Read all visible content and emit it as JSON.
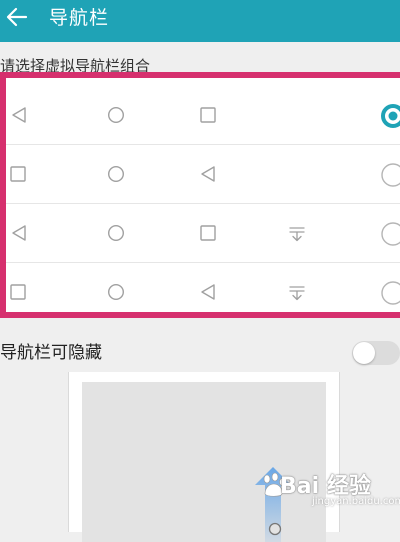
{
  "colors": {
    "header": "#1fa3b6",
    "accent": "#1fa3b6",
    "highlight_border": "#d6306e",
    "icon_stroke": "#a0a0a0"
  },
  "header": {
    "title": "导航栏",
    "back_icon": "arrow-left-icon"
  },
  "subtitle": "请选择虚拟导航栏组合",
  "options": [
    {
      "icons": [
        "back-icon",
        "home-icon",
        "recents-icon"
      ],
      "selected": true
    },
    {
      "icons": [
        "recents-icon",
        "home-icon",
        "back-icon"
      ],
      "selected": false
    },
    {
      "icons": [
        "back-icon",
        "home-icon",
        "recents-icon",
        "notification-pulldown-icon"
      ],
      "selected": false
    },
    {
      "icons": [
        "recents-icon",
        "home-icon",
        "back-icon",
        "notification-pulldown-icon"
      ],
      "selected": false
    }
  ],
  "hide_toggle": {
    "label": "导航栏可隐藏",
    "enabled": false
  },
  "watermark": {
    "text": "Bai 经验",
    "sub": "jingyan.baidu.com"
  }
}
